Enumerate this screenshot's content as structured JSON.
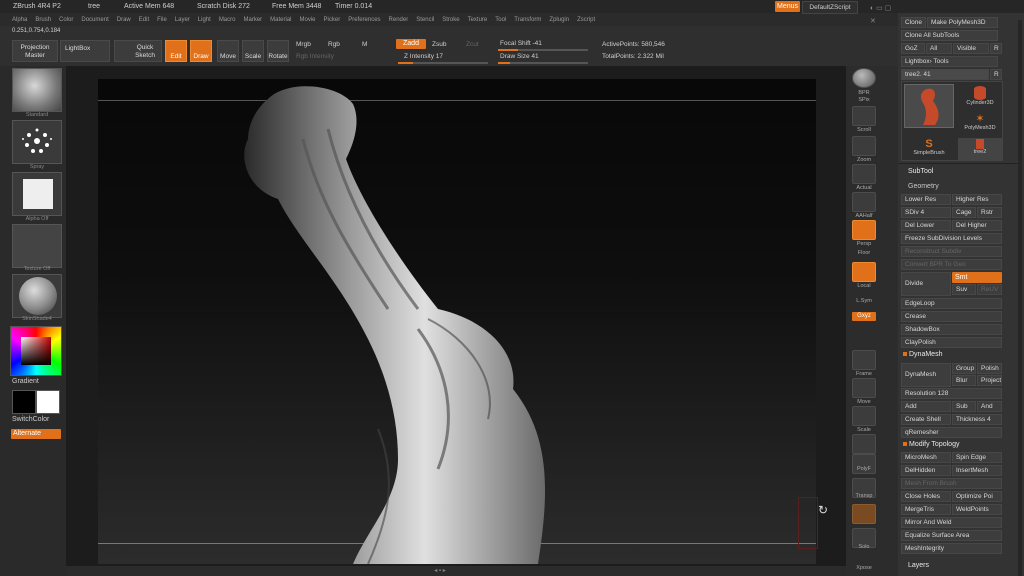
{
  "titlebar": {
    "app": "ZBrush 4R4 P2",
    "doc": "tree",
    "active_mem": "Active Mem 648",
    "scratch": "Scratch Disk 272",
    "free_mem": "Free Mem 3448",
    "timer": "Timer 0.014",
    "menus_btn": "Menus",
    "script_btn": "DefaultZScript"
  },
  "menubar": [
    "Alpha",
    "Brush",
    "Color",
    "Document",
    "Draw",
    "Edit",
    "File",
    "Layer",
    "Light",
    "Macro",
    "Marker",
    "Material",
    "Movie",
    "Picker",
    "Preferences",
    "Render",
    "Stencil",
    "Stroke",
    "Texture",
    "Tool",
    "Transform",
    "Zplugin",
    "Zscript"
  ],
  "coords": "0.251,0.754,0.184",
  "toolbar": {
    "projection": "Projection Master",
    "lightbox": "LightBox",
    "quick_sketch": "Quick Sketch",
    "edit": "Edit",
    "draw": "Draw",
    "move": "Move",
    "scale": "Scale",
    "rotate": "Rotate",
    "mrgb": "Mrgb",
    "rgb": "Rgb",
    "m": "M",
    "rgb_intensity": "Rgb Intensity",
    "zadd": "Zadd",
    "zsub": "Zsub",
    "zcut": "Zcut",
    "z_intensity": "Z Intensity 17",
    "focal_shift": "Focal Shift -41",
    "draw_size": "Draw Size 41",
    "active_points": "ActivePoints: 580,546",
    "total_points": "TotalPoints: 2.322 Mil"
  },
  "lefttray": {
    "brush": "Standard",
    "stroke": "Spray",
    "alpha": "Alpha Off",
    "texture": "Texture Off",
    "material": "SkinShade4",
    "gradient": "Gradient",
    "switch_color": "SwitchColor",
    "alternate": "Alternate"
  },
  "righttray": [
    "BPR",
    "SPix",
    "Scroll",
    "Zoom",
    "Actual",
    "AAHalf",
    "Persp",
    "Floor",
    "Local",
    "L.Sym",
    "Gxyz",
    "Frame",
    "Move",
    "Scale",
    "Rotate",
    "PolyF",
    "Transp",
    "Solo",
    "Xpose"
  ],
  "panel": {
    "clone": "Clone",
    "make_polymesh": "Make PolyMesh3D",
    "clone_all": "Clone All SubTools",
    "goz": "GoZ",
    "all": "All",
    "visible": "Visible",
    "r": "R",
    "lightbox_tools": "Lightbox› Tools",
    "tool_name": "tree2. 41",
    "tools": [
      {
        "name": "tree2"
      },
      {
        "name": "Cylinder3D"
      },
      {
        "name": "PolyMesh3D"
      },
      {
        "name": "SimpleBrush"
      },
      {
        "name": "tree2"
      }
    ],
    "subtool": "SubTool",
    "geometry": "Geometry",
    "lower_res": "Lower Res",
    "higher_res": "Higher Res",
    "sdiv": "SDiv 4",
    "cage": "Cage",
    "rstr": "Rstr",
    "del_lower": "Del Lower",
    "del_higher": "Del Higher",
    "freeze": "Freeze SubDivision Levels",
    "reconstruct": "Reconstruct Subdiv",
    "convert_bpr": "Convert BPR To Geo",
    "divide": "Divide",
    "smt": "Smt",
    "suv": "Suv",
    "reuv": "ReUV",
    "edgeloop": "EdgeLoop",
    "crease": "Crease",
    "shadowbox": "ShadowBox",
    "claypolish": "ClayPolish",
    "dynamesh_h": "DynaMesh",
    "dynamesh": "DynaMesh",
    "group": "Group",
    "polish": "Polish",
    "blur": "Blur",
    "project": "Project",
    "resolution": "Resolution 128",
    "add": "Add",
    "sub": "Sub",
    "and": "And",
    "create_shell": "Create Shell",
    "thickness": "Thickness 4",
    "qremesher": "qRemesher",
    "modify_topology": "Modify Topology",
    "micromesh": "MicroMesh",
    "spin_edge": "Spin Edge",
    "delhidden": "DelHidden",
    "insertmesh": "InsertMesh",
    "mesh_from_brush": "Mesh From Brush",
    "close_holes": "Close Holes",
    "optimize": "Optimize Poi",
    "mergetris": "MergeTris",
    "weldpoints": "WeldPoints",
    "mirror_weld": "Mirror And Weld",
    "equalize": "Equalize Surface Area",
    "meshintegrity": "MeshIntegrity",
    "layers": "Layers"
  },
  "colors": {
    "accent": "#e0701a",
    "bg": "#2b2b2b",
    "panel": "#333333"
  }
}
